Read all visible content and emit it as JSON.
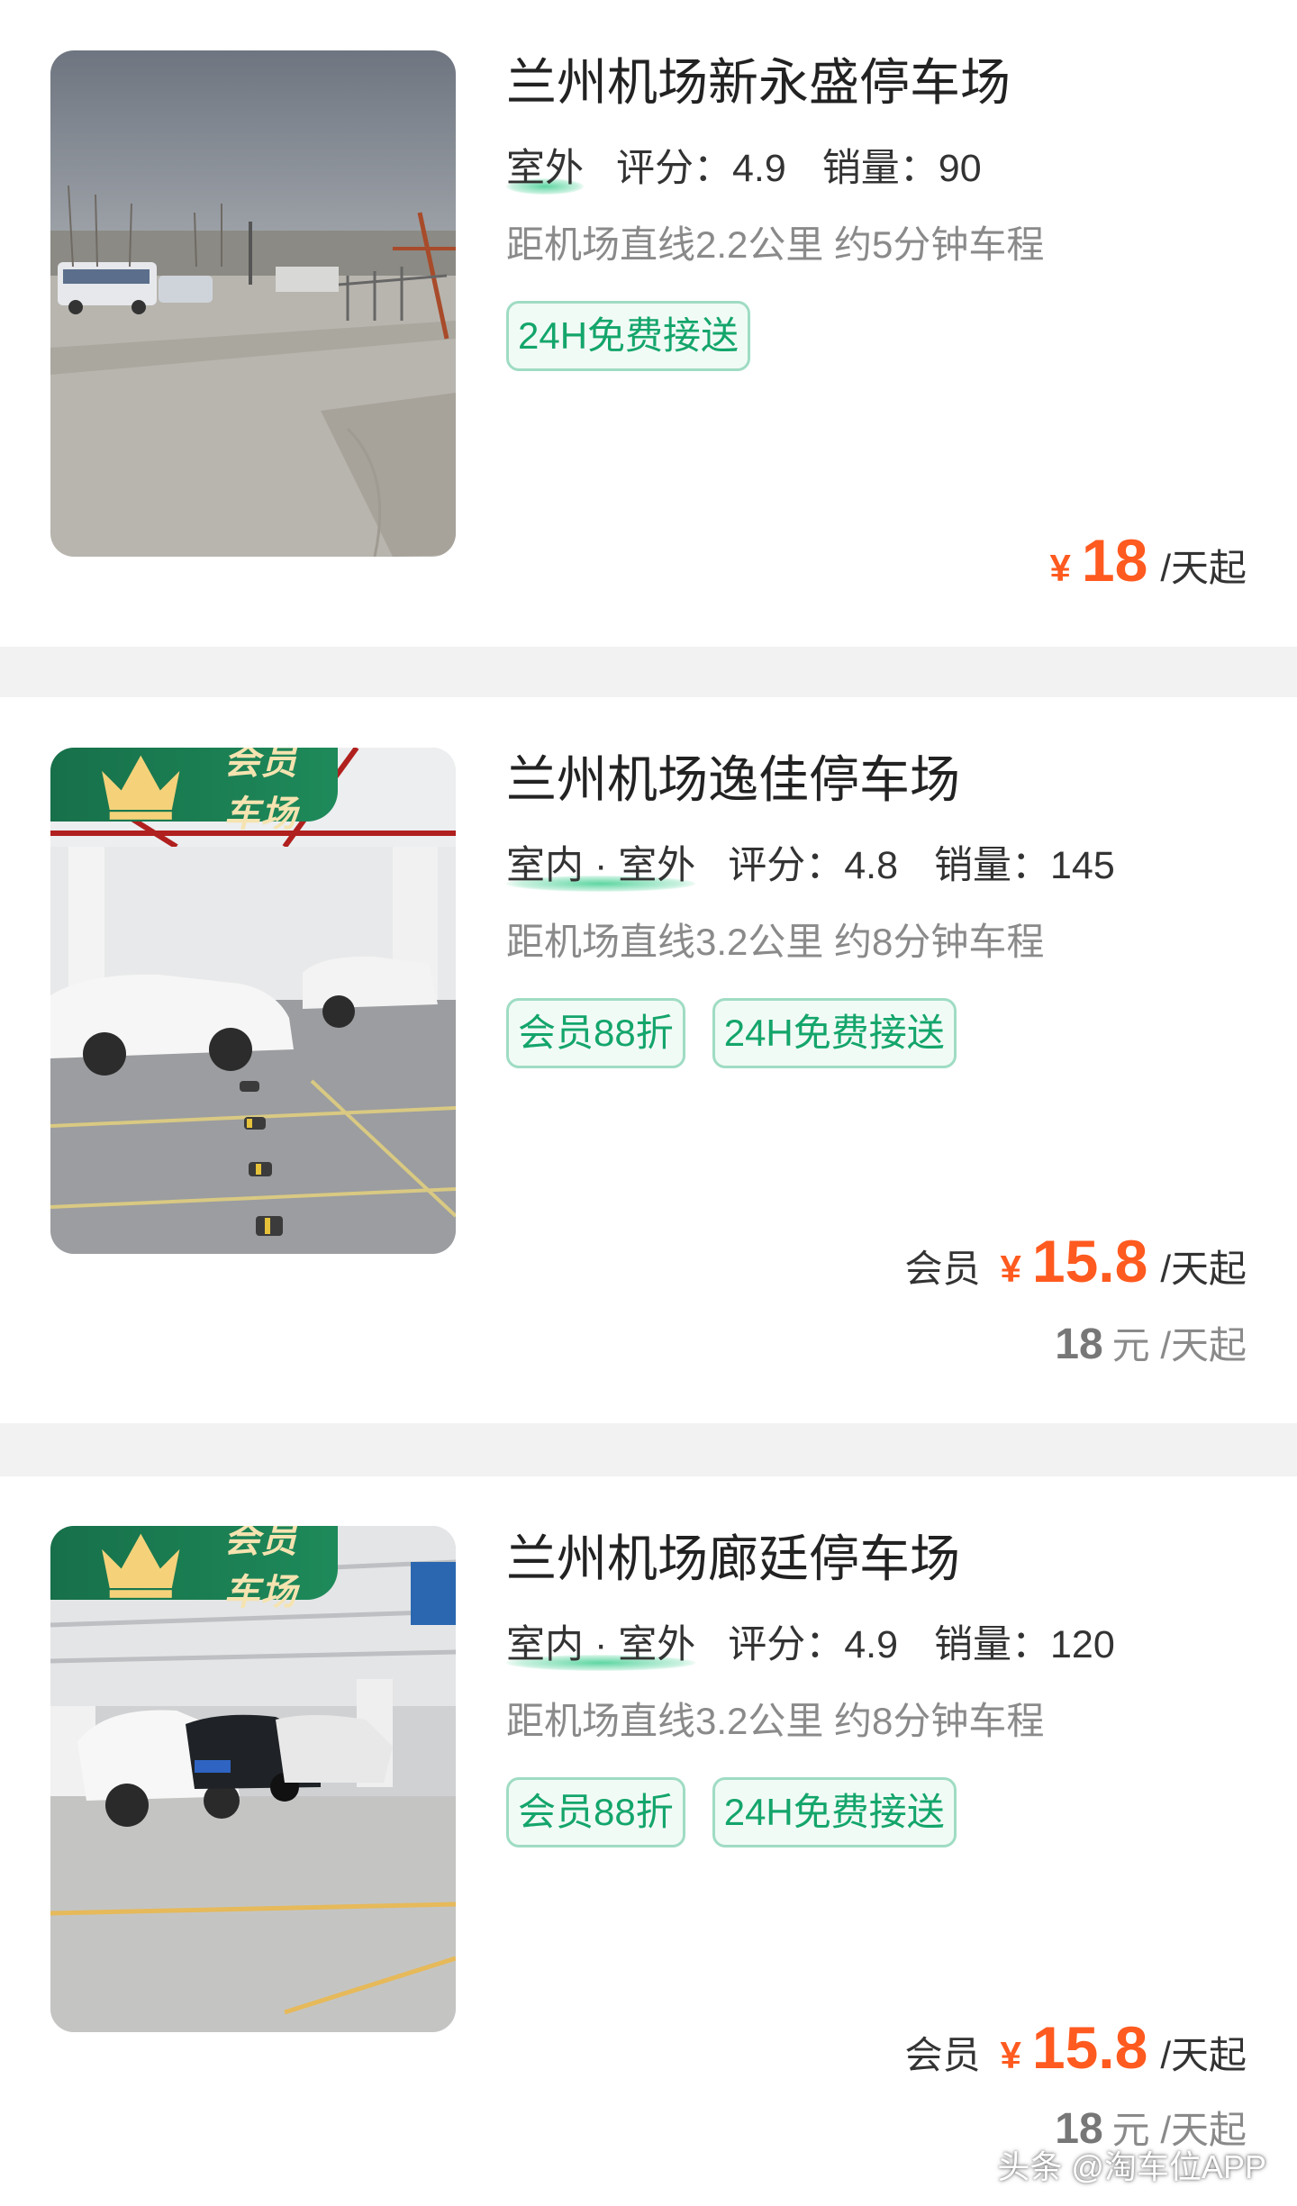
{
  "colors": {
    "accent_green": "#14a56b",
    "price_orange": "#ff5a1f",
    "member_flag_green": "#17704a",
    "member_flag_text": "#f5e3b0"
  },
  "parkings": [
    {
      "name": "兰州机场新永盛停车场",
      "type": "室外",
      "rating_label": "评分：4.9",
      "sales_label": "销量：90",
      "distance": "距机场直线2.2公里 约5分钟车程",
      "tags": [
        "24H免费接送"
      ],
      "price_currency": "¥",
      "price_amount": "18",
      "price_unit": "/天起",
      "is_member_lot": false
    },
    {
      "name": "兰州机场逸佳停车场",
      "type": "室内 · 室外",
      "rating_label": "评分：4.8",
      "sales_label": "销量：145",
      "distance": "距机场直线3.2公里 约8分钟车程",
      "tags": [
        "会员88折",
        "24H免费接送"
      ],
      "member_flag_label": "会员车场",
      "member_price_label": "会员",
      "price_currency": "¥",
      "price_amount": "15.8",
      "price_unit": "/天起",
      "original_amount": "18",
      "original_unit": "元 /天起",
      "is_member_lot": true
    },
    {
      "name": "兰州机场廊廷停车场",
      "type": "室内 · 室外",
      "rating_label": "评分：4.9",
      "sales_label": "销量：120",
      "distance": "距机场直线3.2公里 约8分钟车程",
      "tags": [
        "会员88折",
        "24H免费接送"
      ],
      "member_flag_label": "会员车场",
      "member_price_label": "会员",
      "price_currency": "¥",
      "price_amount": "15.8",
      "price_unit": "/天起",
      "original_amount": "18",
      "original_unit": "元 /天起",
      "is_member_lot": true
    }
  ],
  "watermark": "头条 @淘车位APP",
  "icons": {
    "member_flag": "crown-icon"
  }
}
